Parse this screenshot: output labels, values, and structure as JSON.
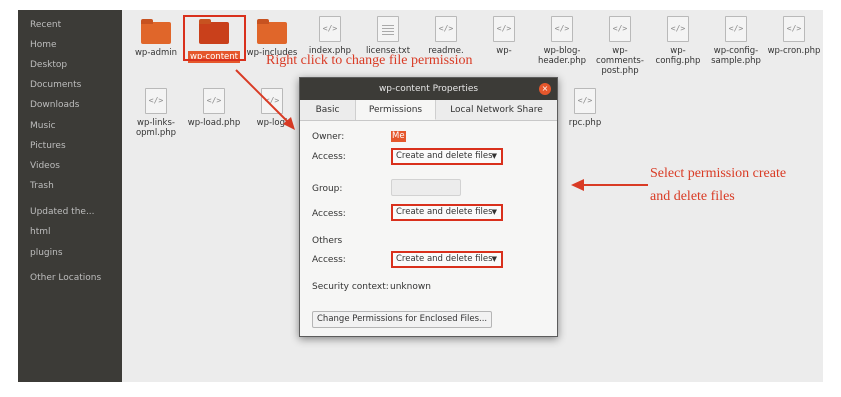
{
  "sidebar": {
    "items": [
      "Recent",
      "Home",
      "Desktop",
      "Documents",
      "Downloads",
      "Music",
      "Pictures",
      "Videos",
      "Trash",
      "Updated the...",
      "html",
      "plugins",
      "Other Locations"
    ]
  },
  "files": {
    "row1": [
      {
        "name": "wp-admin",
        "type": "folder"
      },
      {
        "name": "wp-content",
        "type": "folder-selected"
      },
      {
        "name": "wp-includes",
        "type": "folder"
      },
      {
        "name": "index.php",
        "type": "php"
      },
      {
        "name": "license.txt",
        "type": "txt"
      },
      {
        "name": "readme.",
        "type": "php"
      },
      {
        "name": "wp-",
        "type": "php"
      },
      {
        "name": "wp-blog-header.php",
        "type": "php"
      },
      {
        "name": "wp-comments-post.php",
        "type": "php"
      },
      {
        "name": "wp-config.php",
        "type": "php"
      },
      {
        "name": "wp-config-sample.php",
        "type": "php"
      },
      {
        "name": "wp-cron.php",
        "type": "php"
      }
    ],
    "row2": [
      {
        "name": "wp-links-opml.php",
        "type": "php"
      },
      {
        "name": "wp-load.php",
        "type": "php"
      },
      {
        "name": "wp-logi",
        "type": "php"
      },
      {
        "name": "rpc.php",
        "type": "php"
      }
    ],
    "php_glyph": "</>"
  },
  "annotations": {
    "right_click": "Right click to change file permission",
    "select_line1": "Select permission create",
    "select_line2": "and delete files",
    "color": "#d93b25"
  },
  "dialog": {
    "title": "wp-content Properties",
    "close": "×",
    "tabs": [
      "Basic",
      "Permissions",
      "Local Network Share"
    ],
    "active_tab": "Permissions",
    "owner_label": "Owner:",
    "owner_value": "Me",
    "owner_access_label": "Access:",
    "owner_access_value": "Create and delete files",
    "group_label": "Group:",
    "group_value": "",
    "group_access_label": "Access:",
    "group_access_value": "Create and delete files",
    "others_label": "Others",
    "others_access_label": "Access:",
    "others_access_value": "Create and delete files",
    "security_label": "Security context:",
    "security_value": "unknown",
    "enclosed_button": "Change Permissions for Enclosed Files..."
  },
  "colors": {
    "sidebar_bg": "#3c3b37",
    "accent_orange": "#e5572c",
    "highlight_red": "#d9301c"
  }
}
